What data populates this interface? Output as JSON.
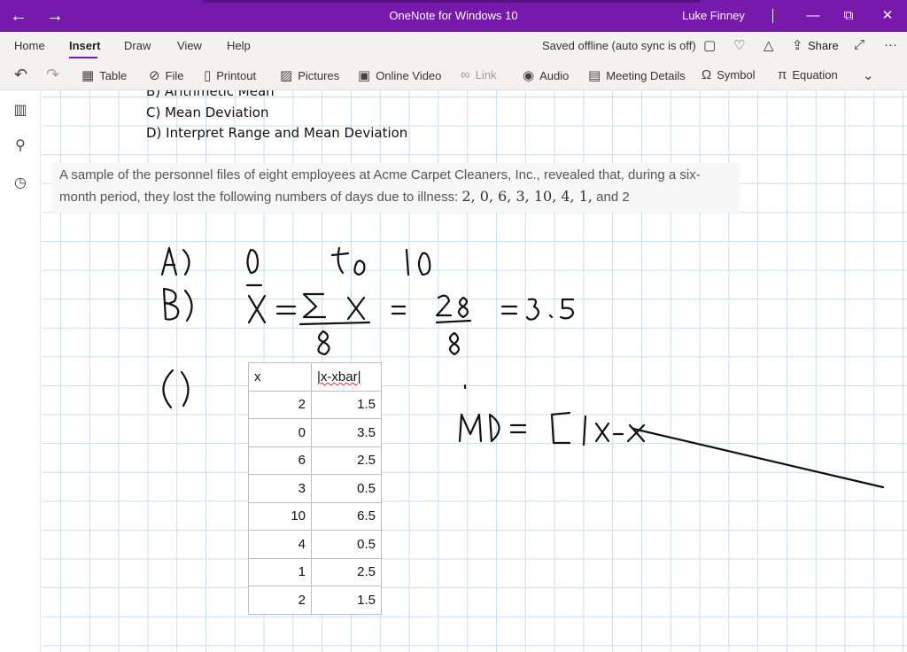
{
  "titlebar": {
    "back": "←",
    "forward": "→",
    "title": "OneNote for Windows 10",
    "user": "Luke Finney",
    "minimize": "—",
    "restore": "⧉",
    "close": "✕"
  },
  "menu": {
    "items": [
      "Home",
      "Insert",
      "Draw",
      "View",
      "Help"
    ],
    "active_index": 1,
    "sync_status": "Saved offline (auto sync is off)",
    "share_label": "Share",
    "more": "···"
  },
  "ribbon": {
    "tools": [
      {
        "label": "Table",
        "icon": "table-icon",
        "glyph": "▦"
      },
      {
        "label": "File",
        "icon": "paperclip-icon",
        "glyph": "⊘"
      },
      {
        "label": "Printout",
        "icon": "printout-icon",
        "glyph": "▯"
      },
      {
        "label": "Pictures",
        "icon": "picture-icon",
        "glyph": "▨"
      },
      {
        "label": "Online Video",
        "icon": "online-video-icon",
        "glyph": "▣"
      },
      {
        "label": "Link",
        "icon": "link-icon",
        "glyph": "∞"
      },
      {
        "label": "Audio",
        "icon": "audio-icon",
        "glyph": "◉"
      },
      {
        "label": "Meeting Details",
        "icon": "meeting-icon",
        "glyph": "▤"
      },
      {
        "label": "Symbol",
        "icon": "omega-icon",
        "glyph": "Ω"
      },
      {
        "label": "Equation",
        "icon": "pi-icon",
        "glyph": "π"
      }
    ],
    "expand": "⌄"
  },
  "page": {
    "list_items": [
      "B) Arithmetic Mean",
      "C) Mean Deviation",
      "D) Interpret Range and Mean Deviation"
    ],
    "problem_text": "A sample of the personnel files of eight employees at Acme Carpet Cleaners, Inc., revealed that, during a six-month period, they lost the following numbers of days due to illness: ",
    "problem_numbers": "2, 0, 6, 3, 10, 4, 1,",
    "problem_tail": " and 2",
    "table": {
      "headers": [
        "x",
        "|x-xbar|"
      ],
      "rows": [
        [
          "2",
          "1.5"
        ],
        [
          "0",
          "3.5"
        ],
        [
          "6",
          "2.5"
        ],
        [
          "3",
          "0.5"
        ],
        [
          "10",
          "6.5"
        ],
        [
          "4",
          "0.5"
        ],
        [
          "1",
          "2.5"
        ],
        [
          "2",
          "1.5"
        ]
      ]
    }
  }
}
